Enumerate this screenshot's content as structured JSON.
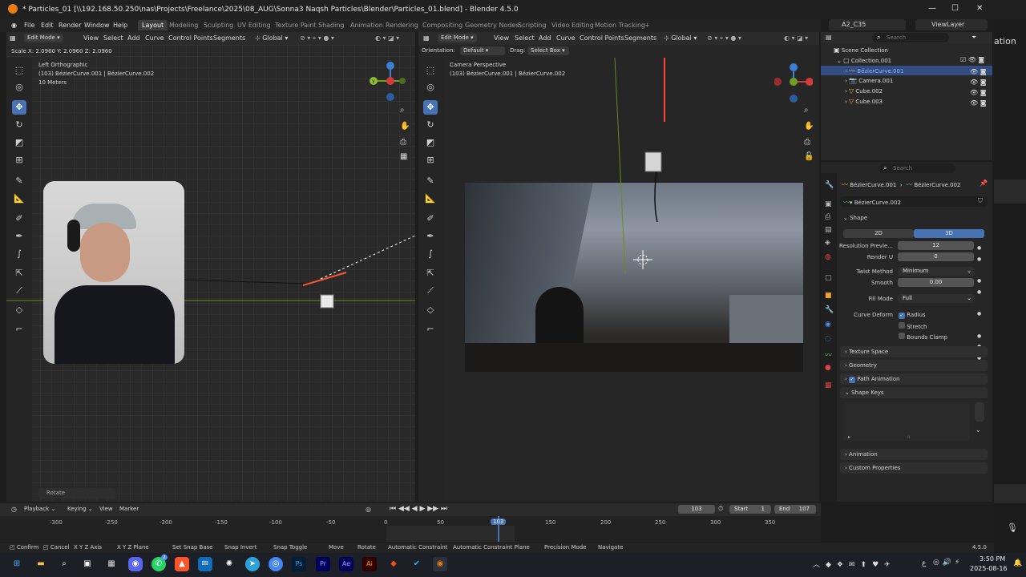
{
  "titlebar": {
    "title": "* Particles_01 [\\\\192.168.50.250\\nas\\Projects\\Freelance\\2025\\08_AUG\\Sonna3 Naqsh Particles\\Blender\\Particles_01.blend] - Blender 4.5.0",
    "minimize": "—",
    "maximize": "☐",
    "close": "✕"
  },
  "menu": {
    "file": "File",
    "edit": "Edit",
    "render": "Render",
    "window": "Window",
    "help": "Help"
  },
  "workspaces": [
    "Layout",
    "Modeling",
    "Sculpting",
    "UV Editing",
    "Texture Paint",
    "Shading",
    "Animation",
    "Rendering",
    "Compositing",
    "Geometry Nodes",
    "Scripting",
    "Video Editing",
    "Motion Tracking",
    "+"
  ],
  "top_right": {
    "scene": "A2_C35",
    "view_layer": "ViewLayer",
    "far_right_text": "ation"
  },
  "left_vp": {
    "mode": "Edit Mode",
    "menus": [
      "View",
      "Select",
      "Add",
      "Curve",
      "Control Points",
      "Segments"
    ],
    "transform": "Global",
    "status": "Scale X: 2.0960   Y: 2.0960   Z: 2.0960",
    "overlay_title": "Left Orthographic",
    "overlay_obj": "(103) BézierCurve.001 | BézierCurve.002",
    "overlay_scale": "10 Meters",
    "rotate_panel": "Rotate",
    "axis_y": "Y",
    "axis_z": "Z",
    "axis_x": "X"
  },
  "right_vp": {
    "mode": "Edit Mode",
    "menus": [
      "View",
      "Select",
      "Add",
      "Curve",
      "Control Points",
      "Segments"
    ],
    "transform": "Global",
    "orientation_label": "Orientation:",
    "orientation_value": "Default",
    "drag_label": "Drag:",
    "drag_value": "Select Box",
    "overlay_title": "Camera Perspective",
    "overlay_obj": "(103) BézierCurve.001 | BézierCurve.002"
  },
  "outliner": {
    "search_placeholder": "Search",
    "root": "Scene Collection",
    "collection": "Collection.001",
    "items": [
      {
        "name": "BézierCurve.001",
        "selected": true
      },
      {
        "name": "Camera.001",
        "selected": false
      },
      {
        "name": "Cube.002",
        "selected": false
      },
      {
        "name": "Cube.003",
        "selected": false
      }
    ]
  },
  "properties": {
    "search_placeholder": "Search",
    "breadcrumb_obj": "BézierCurve.001",
    "breadcrumb_data": "BézierCurve.002",
    "datablock": "BézierCurve.002",
    "shape_title": "Shape",
    "dim_2d": "2D",
    "dim_3d": "3D",
    "resolution_label": "Resolution Previe...",
    "resolution_value": "12",
    "render_u_label": "Render U",
    "render_u_value": "0",
    "twist_label": "Twist Method",
    "twist_value": "Minimum",
    "smooth_label": "Smooth",
    "smooth_value": "0.00",
    "fill_label": "Fill Mode",
    "fill_value": "Full",
    "curve_deform_label": "Curve Deform",
    "radius": "Radius",
    "stretch": "Stretch",
    "bounds_clamp": "Bounds Clamp",
    "sections": [
      "Texture Space",
      "Geometry",
      "Path Animation",
      "Shape Keys"
    ],
    "sections2": [
      "Animation",
      "Custom Properties"
    ]
  },
  "timeline": {
    "playback": "Playback",
    "keying": "Keying",
    "view": "View",
    "marker": "Marker",
    "current": "103",
    "start_label": "Start",
    "start": "1",
    "end_label": "End",
    "end": "107",
    "ticks": [
      "-300",
      "-250",
      "-200",
      "-150",
      "-100",
      "-50",
      "0",
      "50",
      "103",
      "150",
      "200",
      "250",
      "300",
      "350"
    ]
  },
  "statusbar": {
    "items": [
      "Confirm",
      "Cancel",
      "X Y Z Axis",
      "X Y Z Plane",
      "Set Snap Base",
      "Snap Invert",
      "Snap Toggle",
      "Move",
      "Rotate",
      "Automatic Constraint",
      "Automatic Constraint Plane",
      "Precision Mode",
      "Navigate"
    ],
    "version": "4.5.0"
  },
  "taskbar": {
    "time": "3:50 PM",
    "date": "2025-08-16",
    "lang": "ع",
    "chat_badge": "2"
  }
}
